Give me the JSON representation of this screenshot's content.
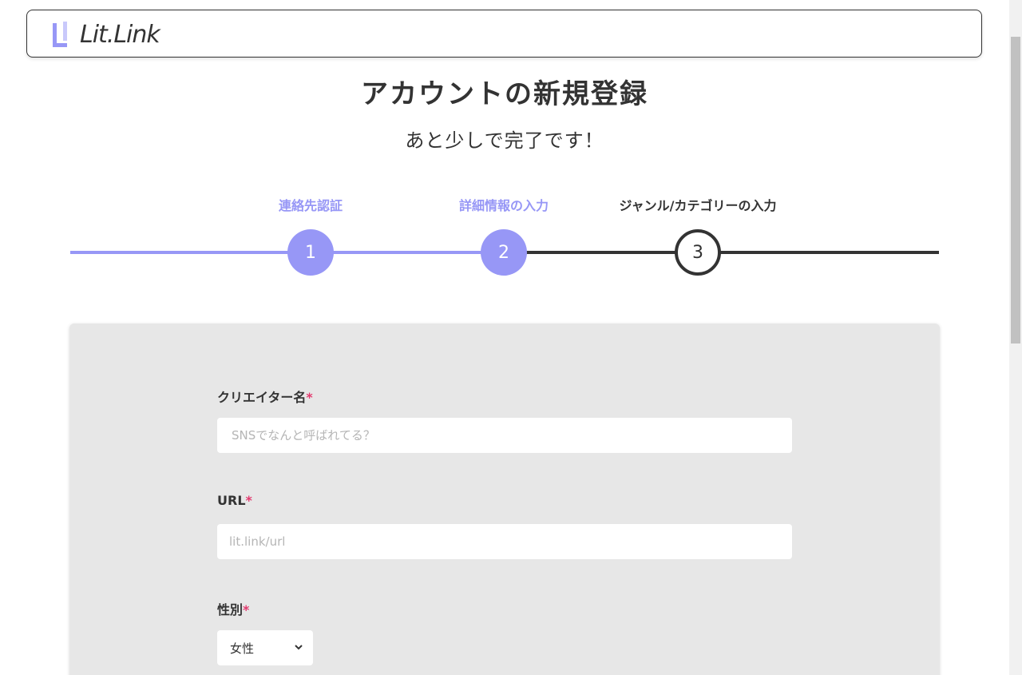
{
  "header": {
    "logo_text": "Lit.Link"
  },
  "page": {
    "title": "アカウントの新規登録",
    "subtitle": "あと少しで完了です！"
  },
  "stepper": {
    "steps": [
      {
        "label": "連絡先認証",
        "number": "1",
        "state": "done"
      },
      {
        "label": "詳細情報の入力",
        "number": "2",
        "state": "done"
      },
      {
        "label": "ジャンル/カテゴリーの入力",
        "number": "3",
        "state": "current"
      }
    ],
    "active_color": "#9797f6",
    "inactive_color": "#333333"
  },
  "form": {
    "creator_name": {
      "label": "クリエイター名",
      "required_mark": "*",
      "value": "",
      "placeholder": "SNSでなんと呼ばれてる？"
    },
    "url": {
      "label": "URL",
      "required_mark": "*",
      "value": "",
      "placeholder": "lit.link/url"
    },
    "gender": {
      "label": "性別",
      "required_mark": "*",
      "selected": "女性"
    }
  },
  "colors": {
    "accent": "#9797f6",
    "required": "#e33a6f",
    "card_bg": "#e7e7e7"
  }
}
